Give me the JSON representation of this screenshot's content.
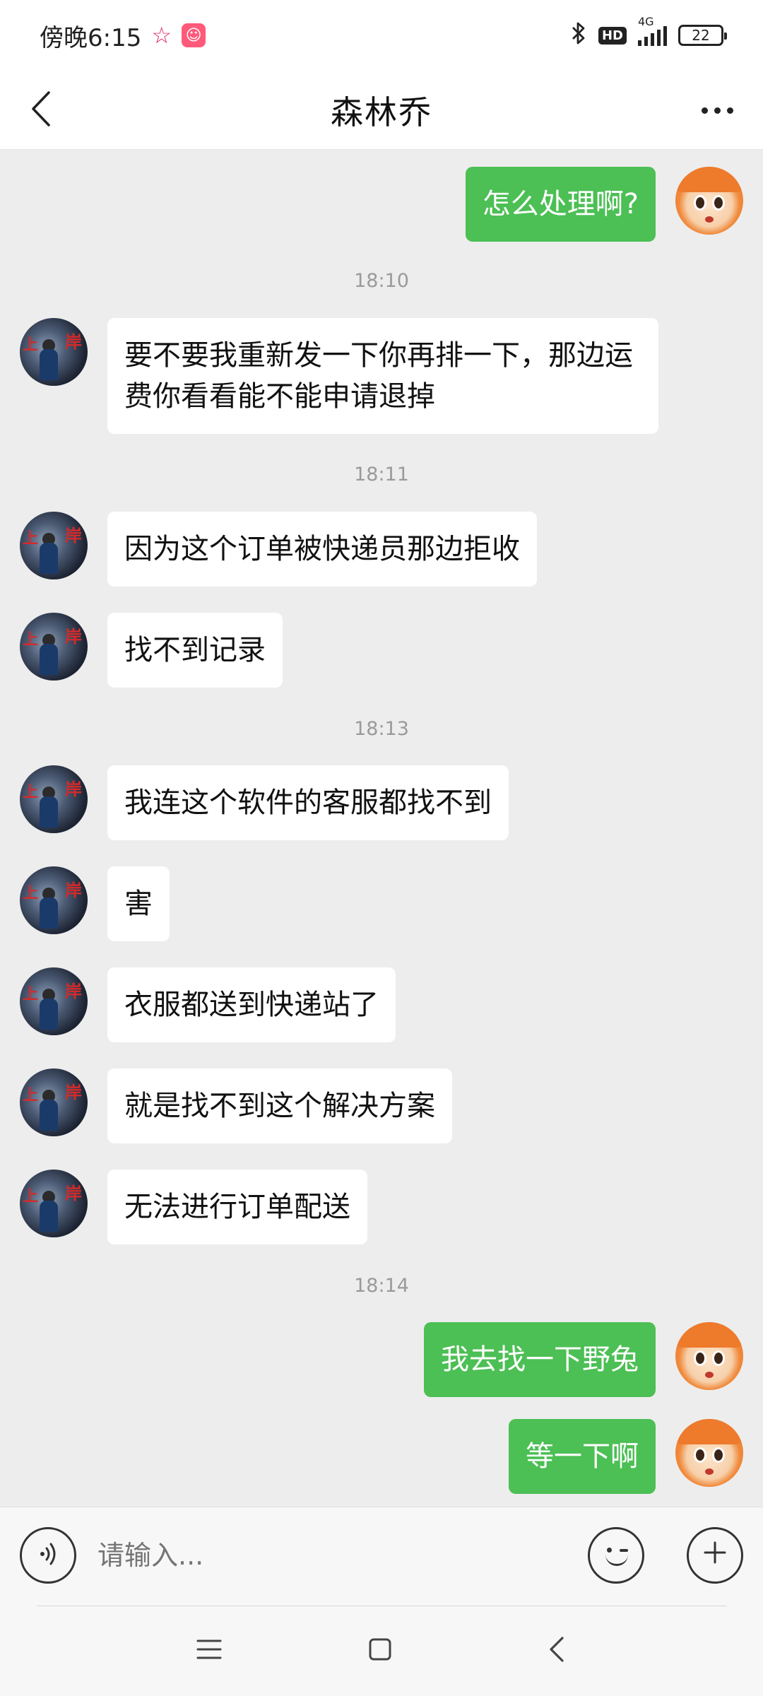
{
  "status_bar": {
    "time": "傍晚6:15",
    "hd": "HD",
    "network": "4G",
    "battery": "22"
  },
  "header": {
    "title": "森林乔"
  },
  "messages": [
    {
      "sender": "me",
      "text": "怎么处理啊?"
    },
    {
      "type": "timestamp",
      "text": "18:10"
    },
    {
      "sender": "other",
      "text": "要不要我重新发一下你再排一下，那边运费你看看能不能申请退掉"
    },
    {
      "type": "timestamp",
      "text": "18:11"
    },
    {
      "sender": "other",
      "text": "因为这个订单被快递员那边拒收"
    },
    {
      "sender": "other",
      "text": "找不到记录"
    },
    {
      "type": "timestamp",
      "text": "18:13"
    },
    {
      "sender": "other",
      "text": "我连这个软件的客服都找不到"
    },
    {
      "sender": "other",
      "text": "害"
    },
    {
      "sender": "other",
      "text": "衣服都送到快递站了"
    },
    {
      "sender": "other",
      "text": "就是找不到这个解决方案"
    },
    {
      "sender": "other",
      "text": "无法进行订单配送"
    },
    {
      "type": "timestamp",
      "text": "18:14"
    },
    {
      "sender": "me",
      "text": "我去找一下野兔"
    },
    {
      "sender": "me",
      "text": "等一下啊"
    }
  ],
  "input": {
    "placeholder": "请输入..."
  },
  "colors": {
    "my_bubble": "#4cbf55",
    "other_bubble": "#ffffff",
    "chat_background": "#ededed"
  },
  "icons": {
    "back": "chevron-left-icon",
    "more": "more-dots-icon",
    "voice": "voice-icon",
    "emoji": "emoji-icon",
    "plus": "plus-icon",
    "nav_menu": "menu-icon",
    "nav_home": "home-icon",
    "nav_back": "back-icon"
  }
}
